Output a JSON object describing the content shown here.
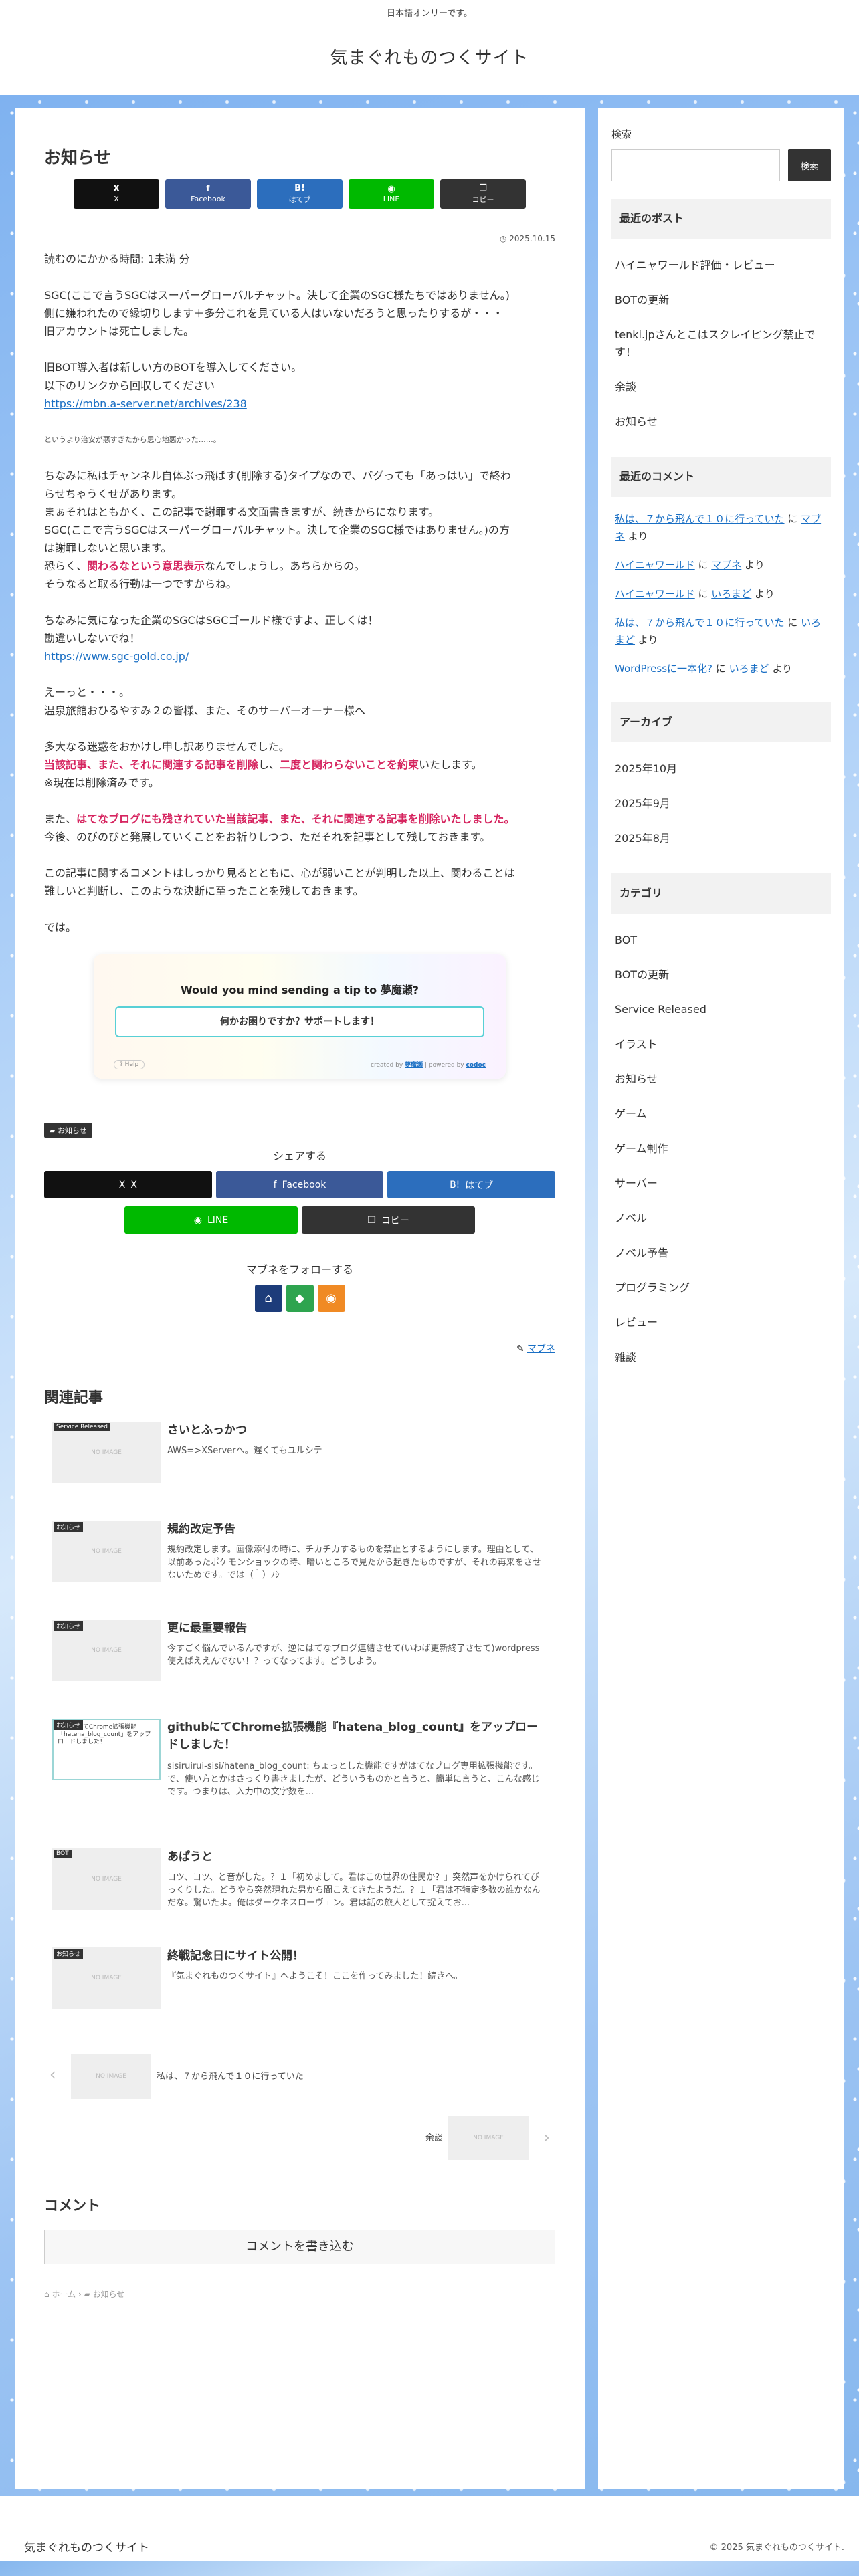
{
  "topbar": {
    "text": "日本語オンリーです。"
  },
  "site": {
    "title": "気まぐれものつくサイト"
  },
  "article": {
    "title": "お知らせ",
    "date": "2025.10.15",
    "share_buttons": [
      {
        "icon": "X",
        "label": "X"
      },
      {
        "icon": "f",
        "label": "Facebook"
      },
      {
        "icon": "B!",
        "label": "はてブ"
      },
      {
        "icon": "◉",
        "label": "LINE"
      },
      {
        "icon": "❐",
        "label": "コピー"
      }
    ],
    "p1": "読むのにかかる時間: 1未満 分",
    "p2_l1": "SGC(ここで言うSGCはスーパーグローバルチャット。決して企業のSGC様たちではありません。)",
    "p2_l2": "側に嫌われたので縁切りします＋多分これを見ている人はいないだろうと思ったりするが・・・",
    "p2_l3": "旧アカウントは死亡しました。",
    "p3_l1": "旧BOT導入者は新しい方のBOTを導入してください。",
    "p3_l2": "以下のリンクから回収してください",
    "p3_link": "https://mbn.a-server.net/archives/238",
    "p4_tiny": "というより治安が悪すぎたから思心地悪かった……。",
    "p5_l1": "ちなみに私はチャンネル自体ぶっ飛ばす(削除する)タイプなので、バグっても「あっはい」で終わ",
    "p5_l2": "らせちゃうくせがあります。",
    "p5_l3": "まぁそれはともかく、この記事で謝罪する文面書きますが、続きからになります。",
    "p5_l4": "SGC(ここで言うSGCはスーパーグローバルチャット。決して企業のSGC様ではありません。)の方",
    "p5_l5": "は謝罪しないと思います。",
    "p5_l6_a": "恐らく、",
    "p5_l6_hl": "関わるなという意思表示",
    "p5_l6_b": "なんでしょうし。あちらからの。",
    "p5_l7": "そうなると取る行動は一つですからね。",
    "p6_l1": "ちなみに気になった企業のSGCはSGCゴールド様ですよ、正しくは！",
    "p6_l2": "勘違いしないでね！",
    "p6_link": "https://www.sgc-gold.co.jp/",
    "p7_l1": "えーっと・・・。",
    "p7_l2": "温泉旅館おひるやすみ２の皆様、また、そのサーバーオーナー様へ",
    "p8_l1": "多大なる迷惑をおかけし申し訳ありませんでした。",
    "p8_l2_hl1": "当該記事、また、それに関連する記事を削除",
    "p8_l2_a": "し、",
    "p8_l2_hl2": "二度と関わらないことを約束",
    "p8_l2_b": "いたします。",
    "p8_l3": "※現在は削除済みです。",
    "p9_l1_a": "また、",
    "p9_l1_hl": "はてなブログにも残されていた当該記事、また、それに関連する記事を削除いたしました。",
    "p9_l2": "今後、のびのびと発展していくことをお祈りしつつ、ただそれを記事として残しておきます。",
    "p10_l1": "この記事に関するコメントはしっかり見るとともに、心が弱いことが判明した以上、関わることは",
    "p10_l2": "難しいと判断し、このような決断に至ったことを残しておきます。",
    "p11": "では。"
  },
  "tip": {
    "title": "Would you mind sending a tip to 夢魔瀬?",
    "button": "何かお困りですか？サポートします！",
    "help": "? Help",
    "created_by": "created by",
    "creator": "夢魔瀬",
    "powered_by": "powered by",
    "powered": "codoc"
  },
  "post_meta": {
    "category": "お知らせ",
    "share_heading": "シェアする",
    "share2": [
      {
        "icon": "X",
        "label": "X"
      },
      {
        "icon": "f",
        "label": "Facebook"
      },
      {
        "icon": "B!",
        "label": "はてブ"
      },
      {
        "icon": "◉",
        "label": "LINE"
      },
      {
        "icon": "❐",
        "label": "コピー"
      }
    ],
    "follow_heading": "マブネをフォローする",
    "author": "マブネ"
  },
  "related": {
    "title": "関連記事",
    "items": [
      {
        "category": "Service Released",
        "title": "さいとふっかつ",
        "desc": "AWS=>XServerへ。遅くてもユルシテ",
        "thumb": "NO IMAGE"
      },
      {
        "category": "お知らせ",
        "title": "規約改定予告",
        "desc": "規約改定します。画像添付の時に、チカチカするものを禁止とするようにします。理由として、以前あったポケモンショックの時、暗いところで見たから起きたものですが、それの再来をさせないためです。では（｀）ﾉｼ",
        "thumb": "NO IMAGE"
      },
      {
        "category": "お知らせ",
        "title": "更に最重要報告",
        "desc": "今すごく悩んでいるんですが、逆にはてなブログ連結させて(いわば更新終了させて)wordpress使えばええんでない！？ってなってます。どうしよう。",
        "thumb": "NO IMAGE"
      },
      {
        "category": "お知らせ",
        "title": "githubにてChrome拡張機能『hatena_blog_count』をアップロードしました！",
        "desc": "sisiruirui-sisi/hatena_blog_count: ちょっとした機能ですがはてなブログ専用拡張機能です。で、使い方とかはさっくり書きましたが、どういうものかと言うと、簡単に言うと、こんな感じです。つまりは、入力中の文字数を...",
        "thumb": "githubにてChrome拡張機能「hatena_blog_count」をアップロードしました！"
      },
      {
        "category": "BOT",
        "title": "あぱうと",
        "desc": "コツ、コツ、と音がした。？１「初めまして。君はこの世界の住民か？」突然声をかけられてびっくりした。どうやら突然現れた男から聞こえてきたようだ。？１「君は不特定多数の誰かなんだな。驚いたよ。俺はダークネスローヴェン。君は話の旅人として捉えてお...",
        "thumb": "NO IMAGE"
      },
      {
        "category": "お知らせ",
        "title": "終戦記念日にサイト公開！",
        "desc": "『気まぐれものつくサイト』へようこそ！ここを作ってみました！続きへ。",
        "thumb": "NO IMAGE"
      }
    ]
  },
  "pager": {
    "prev_title": "私は、７から飛んで１０に行っていた",
    "next_title": "余談",
    "thumb": "NO IMAGE"
  },
  "comments": {
    "title": "コメント",
    "button": "コメントを書き込む"
  },
  "breadcrumb": {
    "home": "ホーム",
    "category": "お知らせ"
  },
  "sidebar": {
    "search_label": "検索",
    "search_button": "検索",
    "recent_posts_title": "最近のポスト",
    "recent_posts": [
      "ハイニャワールド評価・レビュー",
      "BOTの更新",
      "tenki.jpさんとこはスクレイピング禁止です！",
      "余談",
      "お知らせ"
    ],
    "recent_comments_title": "最近のコメント",
    "recent_comments": [
      {
        "post": "私は、７から飛んで１０に行っていた",
        "sep": "に",
        "author": "マブネ",
        "suffix": "より"
      },
      {
        "post": "ハイニャワールド",
        "sep": "に",
        "author": "マブネ",
        "suffix": "より"
      },
      {
        "post": "ハイニャワールド",
        "sep": "に",
        "author": "いろまど",
        "suffix": "より"
      },
      {
        "post": "私は、７から飛んで１０に行っていた",
        "sep": "に",
        "author": "いろまど",
        "suffix": "より"
      },
      {
        "post": "WordPressに一本化?",
        "sep": "に",
        "author": "いろまど",
        "suffix": "より"
      }
    ],
    "archives_title": "アーカイブ",
    "archives": [
      "2025年10月",
      "2025年9月",
      "2025年8月"
    ],
    "categories_title": "カテゴリ",
    "categories": [
      "BOT",
      "BOTの更新",
      "Service Released",
      "イラスト",
      "お知らせ",
      "ゲーム",
      "ゲーム制作",
      "サーバー",
      "ノベル",
      "ノベル予告",
      "プログラミング",
      "レビュー",
      "雑談"
    ]
  },
  "footer": {
    "title": "気まぐれものつくサイト",
    "copyright": "© 2025 気まぐれものつくサイト."
  },
  "colors": {
    "highlight": "#d6245f",
    "link": "#1a6fc4",
    "line_green": "#00b900",
    "facebook": "#3b5998",
    "hatena": "#2c6ebd"
  }
}
